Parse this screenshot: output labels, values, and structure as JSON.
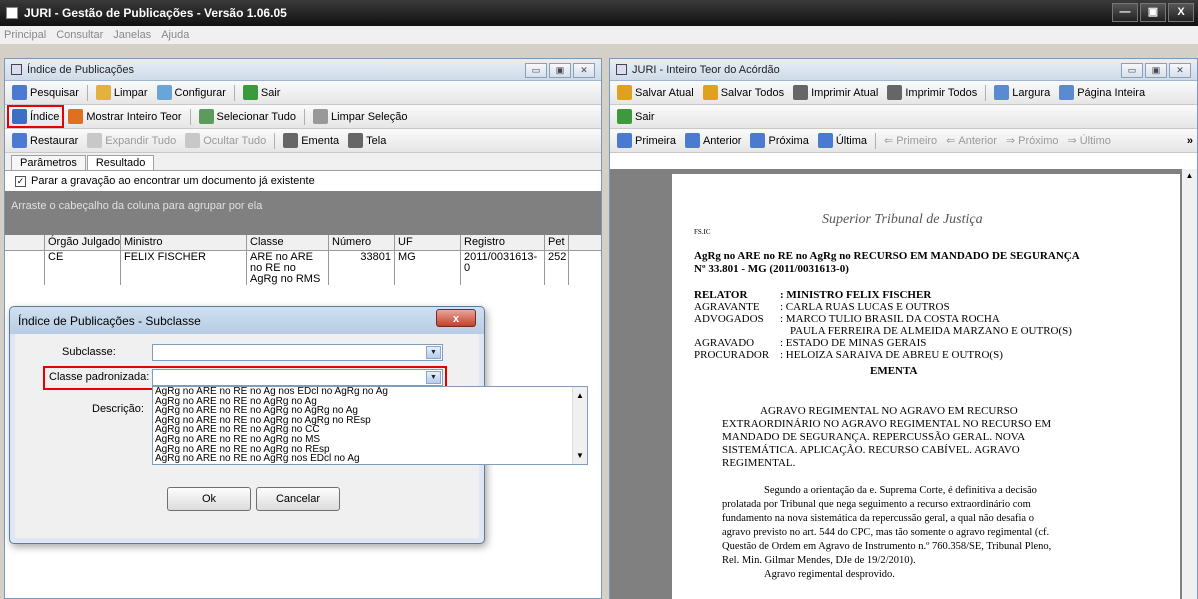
{
  "app": {
    "title": "JURI - Gestão de Publicações - Versão 1.06.05",
    "menu": [
      "Principal",
      "Consultar",
      "Janelas",
      "Ajuda"
    ],
    "window_buttons": [
      "—",
      "▣",
      "X"
    ]
  },
  "left_window": {
    "title": "Índice de Publicações",
    "toolbar1": [
      "Pesquisar",
      "Limpar",
      "Configurar",
      "Sair"
    ],
    "toolbar2": [
      "Índice",
      "Mostrar Inteiro Teor",
      "Selecionar Tudo",
      "Limpar Seleção"
    ],
    "toolbar3": [
      "Restaurar",
      "Expandir Tudo",
      "Ocultar Tudo",
      "Ementa",
      "Tela"
    ],
    "tabs": [
      "Parâmetros",
      "Resultado"
    ],
    "checkbox_label": "Parar a gravação ao encontrar um documento já existente",
    "group_hint": "Arraste o cabeçalho da coluna para agrupar por ela",
    "columns": [
      "Órgão Julgador",
      "Ministro",
      "Classe",
      "Número",
      "UF",
      "Registro",
      "Pet"
    ],
    "row": {
      "orgao": "CE",
      "ministro": "FELIX FISCHER",
      "classe": "ARE no ARE no RE no AgRg no RMS",
      "numero": "33801",
      "uf": "MG",
      "registro": "2011/0031613-0",
      "pet": "252"
    }
  },
  "dialog": {
    "title": "Índice de Publicações - Subclasse",
    "close": "x",
    "subclasse_label": "Subclasse:",
    "subclasse_value": "",
    "classe_label": "Classe padronizada:",
    "classe_value": "",
    "descricao_label": "Descrição:",
    "options": [
      "AgRg no ARE no RE no Ag nos EDcl no AgRg no Ag",
      "AgRg no ARE no RE no AgRg no Ag",
      "AgRg no ARE no RE no AgRg no AgRg no Ag",
      "AgRg no ARE no RE no AgRg no AgRg no REsp",
      "AgRg no ARE no RE no AgRg no CC",
      "AgRg no ARE no RE no AgRg no MS",
      "AgRg no ARE no RE no AgRg no REsp",
      "AgRg no ARE no RE no AgRg nos EDcl no Ag"
    ],
    "ok": "Ok",
    "cancel": "Cancelar"
  },
  "right_window": {
    "title": "JURI - Inteiro Teor do Acórdão",
    "toolbar1": [
      "Salvar Atual",
      "Salvar Todos",
      "Imprimir Atual",
      "Imprimir Todos",
      "Largura",
      "Página Inteira"
    ],
    "toolbar2": [
      "Sair"
    ],
    "toolbar3": [
      "Primeira",
      "Anterior",
      "Próxima",
      "Última",
      "Primeiro",
      "Anterior",
      "Próximo",
      "Último"
    ],
    "overflow": "»"
  },
  "document": {
    "court": "Superior Tribunal de Justiça",
    "header_tag": "FS.IC",
    "case_title": "AgRg no ARE no RE no AgRg no RECURSO EM MANDADO DE SEGURANÇA",
    "case_number": "Nº 33.801 - MG (2011/0031613-0)",
    "parties": [
      {
        "role": "RELATOR",
        "name": ": MINISTRO FELIX FISCHER"
      },
      {
        "role": "AGRAVANTE",
        "name": ": CARLA RUAS LUCAS E OUTROS"
      },
      {
        "role": "ADVOGADOS",
        "name": ": MARCO TULIO BRASIL DA COSTA ROCHA"
      },
      {
        "role": "",
        "name": "PAULA FERREIRA DE ALMEIDA MARZANO E OUTRO(S)"
      },
      {
        "role": "AGRAVADO",
        "name": ": ESTADO DE MINAS GERAIS"
      },
      {
        "role": "PROCURADOR",
        "name": ": HELOIZA SARAIVA DE ABREU E OUTRO(S)"
      }
    ],
    "ementa_heading": "EMENTA",
    "ementa_lines": [
      "AGRAVO REGIMENTAL NO AGRAVO EM RECURSO",
      "EXTRAORDINÁRIO NO AGRAVO REGIMENTAL NO RECURSO EM",
      "MANDADO DE SEGURANÇA. REPERCUSSÃO GERAL. NOVA",
      "SISTEMÁTICA. APLICAÇÃO. RECURSO CABÍVEL. AGRAVO",
      "REGIMENTAL."
    ],
    "body_lines": [
      "Segundo a orientação da e. Suprema Corte, é definitiva a decisão",
      "prolatada por Tribunal que nega seguimento a recurso extraordinário com",
      "fundamento na nova sistemática da repercussão geral, a qual não desafia o",
      "agravo previsto no art. 544 do CPC, mas tão somente o agravo regimental (cf.",
      "Questão de Ordem em Agravo de Instrumento n.º 760.358/SE, Tribunal Pleno,",
      "Rel. Min. Gilmar Mendes, DJe de 19/2/2010).",
      "Agravo regimental desprovido."
    ]
  }
}
